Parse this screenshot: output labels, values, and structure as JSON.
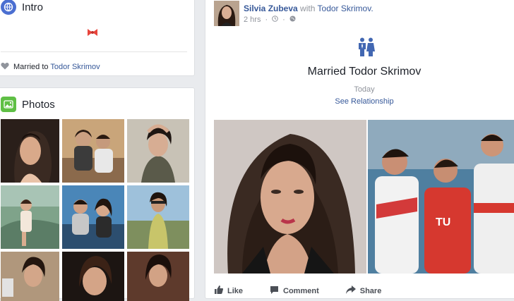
{
  "intro": {
    "title": "Intro",
    "married_prefix": "Married to ",
    "spouse": "Todor Skrimov"
  },
  "photos": {
    "title": "Photos"
  },
  "post": {
    "author": "Silvia Zubeva",
    "with_text": "with",
    "tagged": "Todor Skrimov.",
    "time": "2 hrs",
    "headline": "Married Todor Skrimov",
    "date": "Today",
    "link": "See Relationship",
    "actions": {
      "like": "Like",
      "comment": "Comment",
      "share": "Share"
    }
  },
  "colors": {
    "accent": "#365899",
    "background": "#e9ebee",
    "intro_icon": "#4b6fd1",
    "photos_icon": "#5fbf45",
    "bow": "#e8453c"
  },
  "icons": [
    "globe-icon",
    "bow-icon",
    "heart-icon",
    "photo-icon",
    "clock-icon",
    "public-globe-icon",
    "couple-icon",
    "like-icon",
    "comment-icon",
    "share-icon"
  ]
}
